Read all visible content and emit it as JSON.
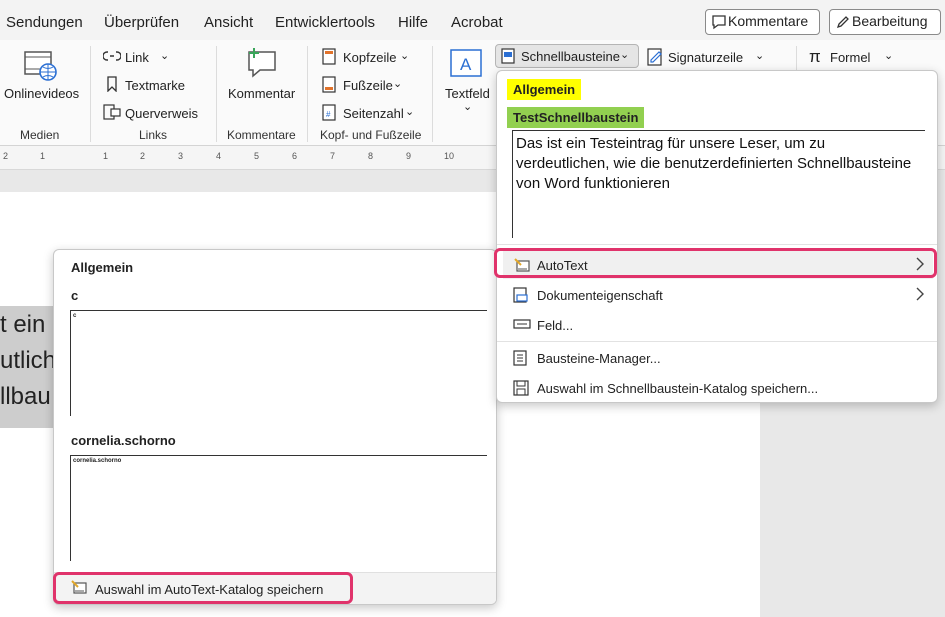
{
  "tabs": {
    "sendungen": "Sendungen",
    "ueberpruefen": "Überprüfen",
    "ansicht": "Ansicht",
    "entwicklertools": "Entwicklertools",
    "hilfe": "Hilfe",
    "acrobat": "Acrobat"
  },
  "top_buttons": {
    "kommentare": "Kommentare",
    "bearbeitung": "Bearbeitung"
  },
  "ribbon": {
    "onlinevideos": "Onlinevideos",
    "medien": "Medien",
    "link": "Link",
    "textmarke": "Textmarke",
    "querverweis": "Querverweis",
    "links": "Links",
    "kommentar": "Kommentar",
    "kommentare_group": "Kommentare",
    "kopfzeile": "Kopfzeile",
    "fusszeile": "Fußzeile",
    "seitenzahl": "Seitenzahl",
    "kopf_fuss_group": "Kopf- und Fußzeile",
    "textfeld": "Textfeld",
    "schnellbausteine": "Schnellbausteine",
    "signaturzeile": "Signaturzeile",
    "formel": "Formel"
  },
  "ruler_ticks": [
    "2",
    "1",
    "1",
    "2",
    "3",
    "4",
    "5",
    "6",
    "7",
    "8",
    "9",
    "10"
  ],
  "document": {
    "lines": [
      "t ein",
      "utlich",
      "llbau"
    ]
  },
  "autotext_popup": {
    "section": "Allgemein",
    "entries": [
      {
        "name": "c",
        "preview": "c"
      },
      {
        "name": "cornelia.schorno",
        "preview": "cornelia.schorno"
      }
    ],
    "save_action": "Auswahl im AutoText-Katalog speichern"
  },
  "quickparts_popup": {
    "category_allgemein": "Allgemein",
    "category_test": "TestSchnellbaustein",
    "preview_text": "Das ist ein Testeintrag für unsere Leser, um zu verdeutlichen, wie die benutzerdefinierten Schnellbausteine von Word funktionieren",
    "menu": {
      "autotext": "AutoText",
      "dokumenteigenschaft": "Dokumenteigenschaft",
      "feld": "Feld...",
      "bausteine_manager": "Bausteine-Manager...",
      "auswahl_speichern": "Auswahl im Schnellbaustein-Katalog speichern..."
    }
  },
  "colors": {
    "highlight_yellow": "#ffff00",
    "highlight_green": "#92d050",
    "callout_pink": "#e0336b",
    "accent_blue": "#2b6fd3"
  }
}
